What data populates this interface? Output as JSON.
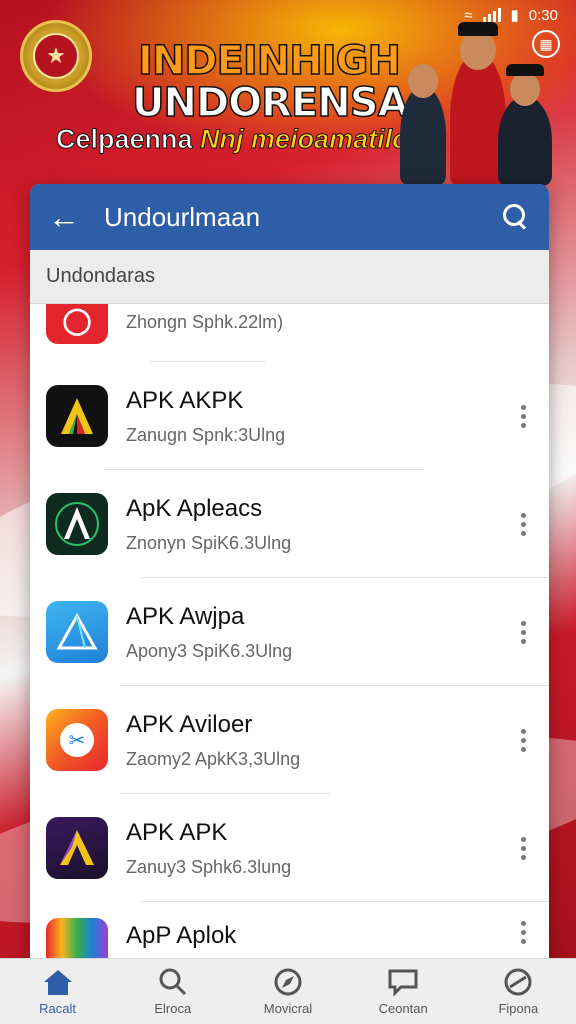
{
  "status_bar": {
    "time": "0:30"
  },
  "banner": {
    "headline_line1": "INDEINHIGH",
    "headline_line2": "UNDORENSAA",
    "headline_line3_plain": "Celpaenna ",
    "headline_line3_accent": "Nnj meioamatiloa"
  },
  "app_bar": {
    "title": "Undourlmaan"
  },
  "subheader": {
    "label": "Undondaras"
  },
  "apps": [
    {
      "name": "",
      "meta": "Zhongn Sphk.22lm)",
      "icon": "red-app-icon"
    },
    {
      "name": "APK AKPK",
      "meta": "Zanugn Spnk:3Ulng",
      "icon": "dark-a-app-icon"
    },
    {
      "name": "ApK Apleacs",
      "meta": "Znonyn SpiK6.3Ulng",
      "icon": "green-a-app-icon"
    },
    {
      "name": "APK Awjpa",
      "meta": "Apony3 SpiK6.3Ulng",
      "icon": "blue-triangle-app-icon"
    },
    {
      "name": "APK Aviloer",
      "meta": "Zaomy2 ApkK3,3Ulng",
      "icon": "orange-scissors-app-icon"
    },
    {
      "name": "APK APK",
      "meta": "Zanuy3 Sphk6.3lung",
      "icon": "purple-a-app-icon"
    },
    {
      "name": "ApP Aplok",
      "meta": "",
      "icon": "rainbow-app-icon"
    }
  ],
  "bottom_nav": [
    {
      "label": "Racalt",
      "icon": "home-icon",
      "active": true
    },
    {
      "label": "Elroca",
      "icon": "search-icon",
      "active": false
    },
    {
      "label": "Movicral",
      "icon": "explore-icon",
      "active": false
    },
    {
      "label": "Ceontan",
      "icon": "message-icon",
      "active": false
    },
    {
      "label": "Fipona",
      "icon": "profile-icon",
      "active": false
    }
  ],
  "colors": {
    "accent": "#2f5ea8",
    "banner_red": "#c8192a",
    "headline_orange": "#ff9a1a"
  }
}
